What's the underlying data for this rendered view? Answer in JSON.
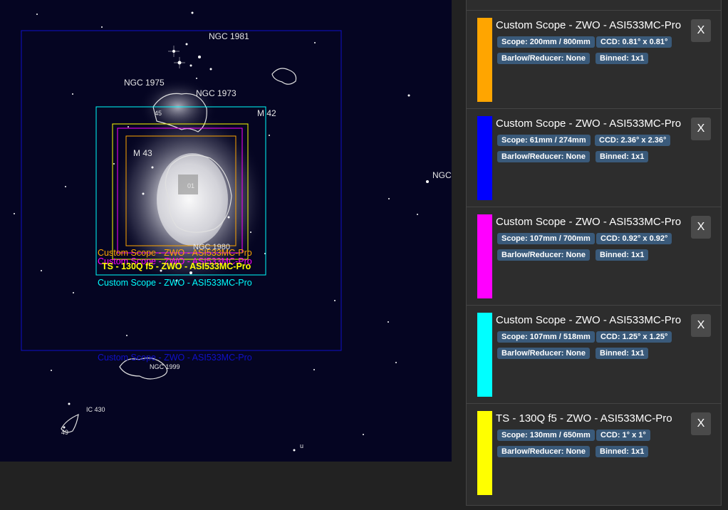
{
  "sky_map": {
    "objects": [
      {
        "label": "NGC 1981",
        "size": "12"
      },
      {
        "label": "NGC 1975",
        "size": "12"
      },
      {
        "label": "NGC 1973",
        "size": "12"
      },
      {
        "label": "M 42",
        "size": "12"
      },
      {
        "label": "M 43",
        "size": "12"
      },
      {
        "label": "NGC 1980",
        "size": "11"
      },
      {
        "label": "NGC 1999",
        "size": "9"
      },
      {
        "label": "IC 430",
        "size": "9"
      },
      {
        "label": "NGC",
        "size": "12"
      },
      {
        "label": "45",
        "size": "9"
      },
      {
        "label": "01",
        "size": "9"
      },
      {
        "label": "49",
        "size": "9"
      },
      {
        "label": "u",
        "size": "9"
      }
    ],
    "fov_labels": [
      {
        "text": "Custom Scope - ZWO - ASI533MC-Pro",
        "color": "#ffa500"
      },
      {
        "text": "Custom Scope - ZWO - ASI533MC-Pro",
        "color": "#ff00ff"
      },
      {
        "text": "TS - 130Q f5 - ZWO - ASI533MC-Pro",
        "color": "#ffff00"
      },
      {
        "text": "Custom Scope - ZWO - ASI533MC-Pro",
        "color": "#00ffff"
      },
      {
        "text": "Custom Scope - ZWO - ASI533MC-Pro",
        "color": "#1010c8"
      }
    ]
  },
  "equipment": [
    {
      "color": "#ffa500",
      "title": "Custom Scope - ZWO - ASI533MC-Pro",
      "scope": "Scope: 200mm / 800mm",
      "ccd": "CCD: 0.81° x 0.81°",
      "barlow": "Barlow/Reducer: None",
      "binned": "Binned: 1x1",
      "close": "X"
    },
    {
      "color": "#0000ff",
      "title": "Custom Scope - ZWO - ASI533MC-Pro",
      "scope": "Scope: 61mm / 274mm",
      "ccd": "CCD: 2.36° x 2.36°",
      "barlow": "Barlow/Reducer: None",
      "binned": "Binned: 1x1",
      "close": "X"
    },
    {
      "color": "#ff00ff",
      "title": "Custom Scope - ZWO - ASI533MC-Pro",
      "scope": "Scope: 107mm / 700mm",
      "ccd": "CCD: 0.92° x 0.92°",
      "barlow": "Barlow/Reducer: None",
      "binned": "Binned: 1x1",
      "close": "X"
    },
    {
      "color": "#00ffff",
      "title": "Custom Scope - ZWO - ASI533MC-Pro",
      "scope": "Scope: 107mm / 518mm",
      "ccd": "CCD: 1.25° x 1.25°",
      "barlow": "Barlow/Reducer: None",
      "binned": "Binned: 1x1",
      "close": "X"
    },
    {
      "color": "#ffff00",
      "title": "TS - 130Q f5 - ZWO - ASI533MC-Pro",
      "scope": "Scope: 130mm / 650mm",
      "ccd": "CCD: 1° x 1°",
      "barlow": "Barlow/Reducer: None",
      "binned": "Binned: 1x1",
      "close": "X"
    }
  ]
}
